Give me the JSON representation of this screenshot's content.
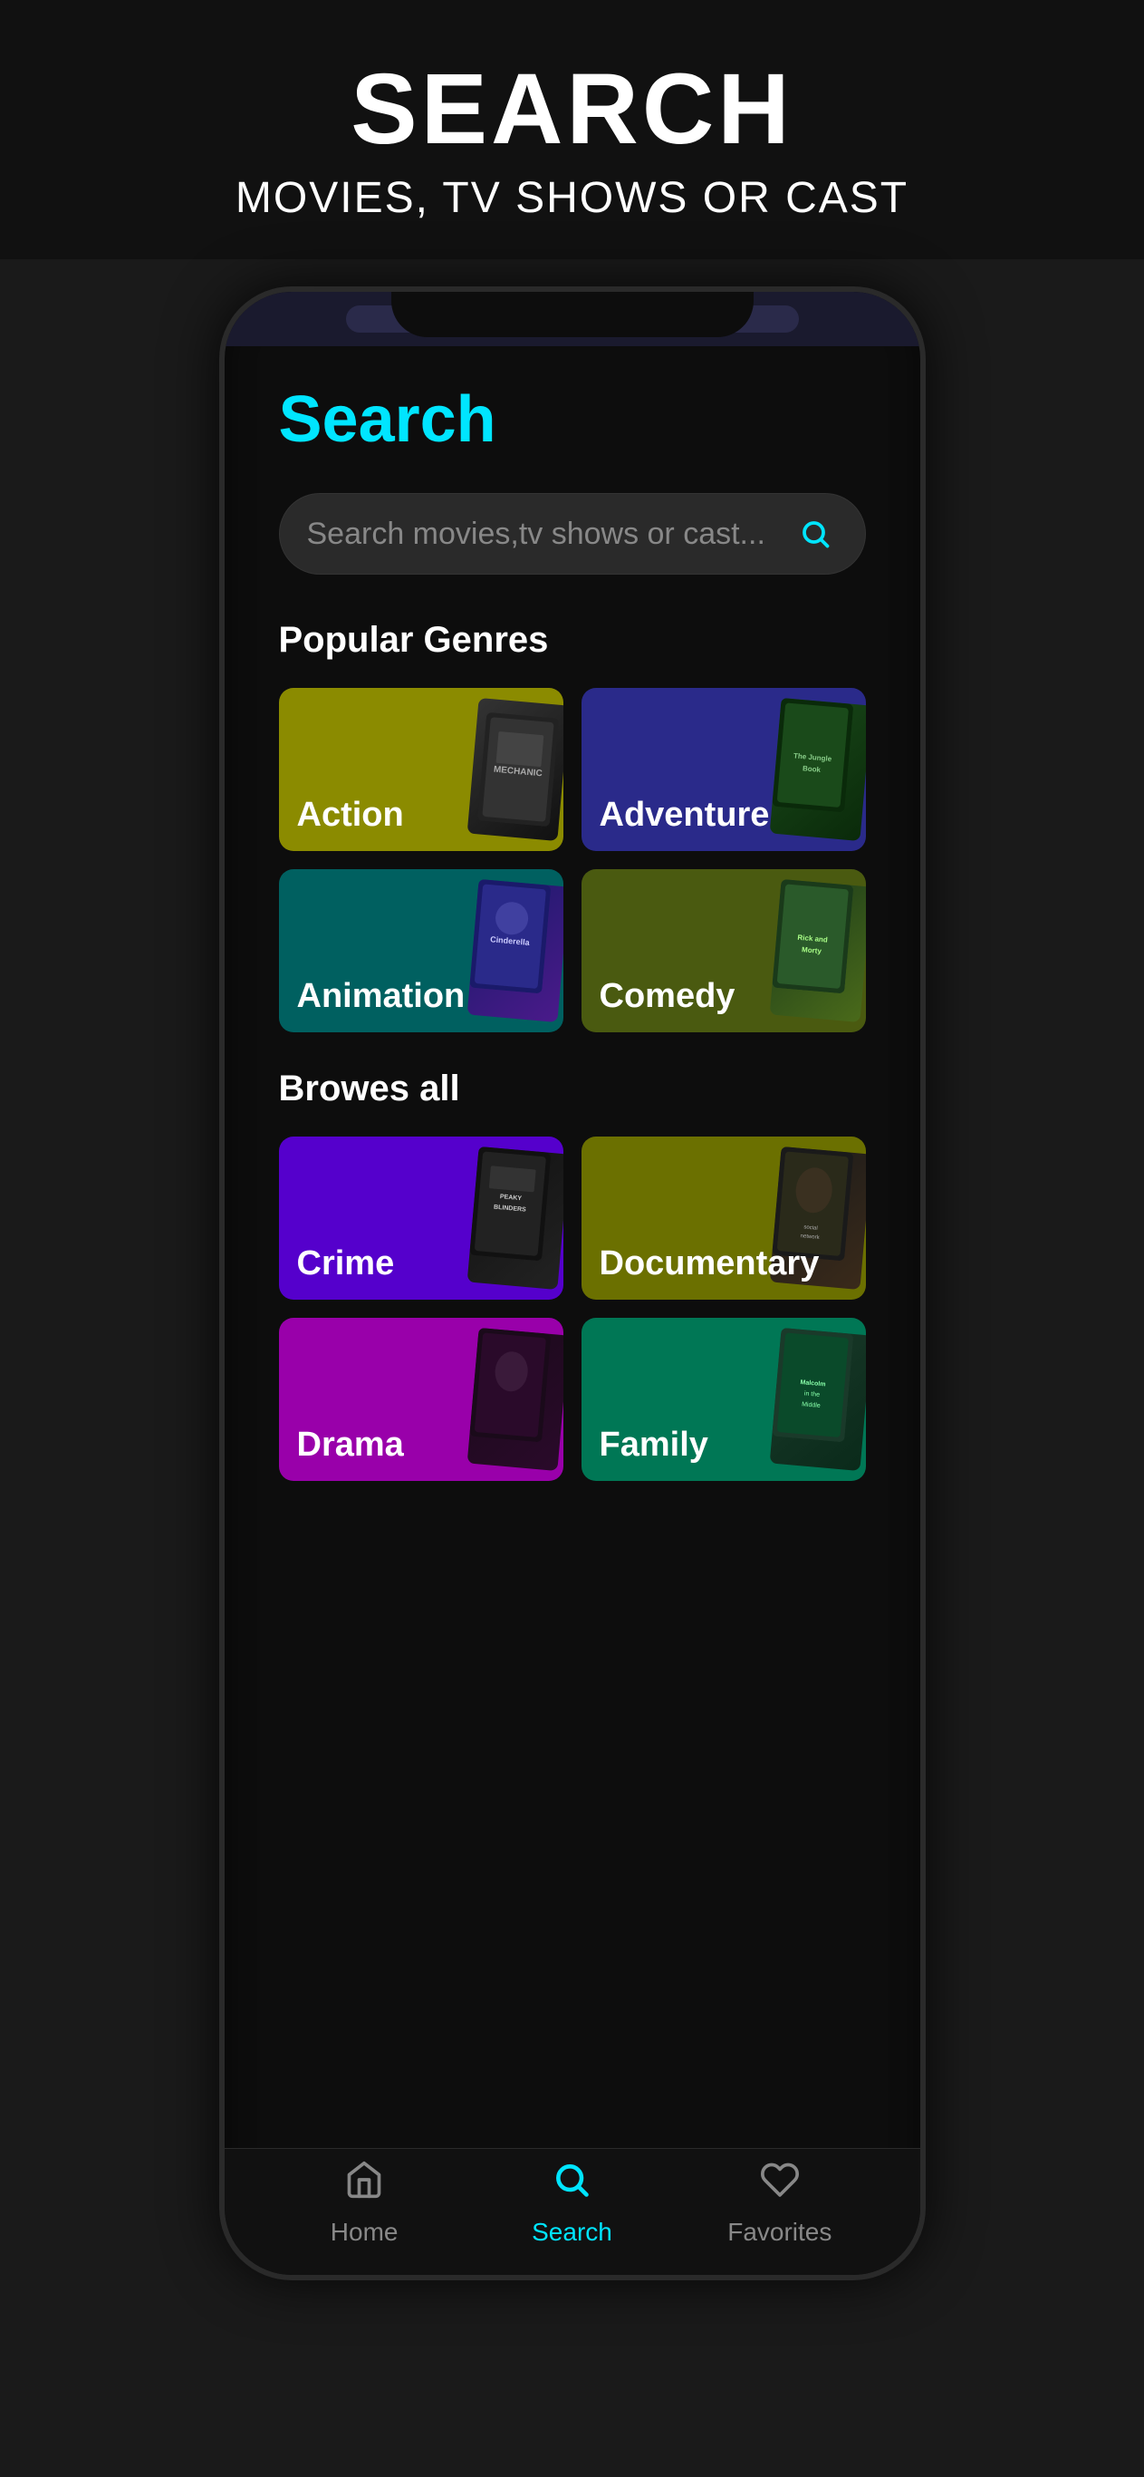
{
  "header": {
    "title": "SEARCH",
    "subtitle": "MOVIES, TV SHOWS OR CAST"
  },
  "search_page": {
    "title": "Search",
    "search_placeholder": "Search movies,tv shows or cast...",
    "popular_genres_label": "Popular Genres",
    "browses_all_label": "Browes all",
    "genres_popular": [
      {
        "id": "action",
        "label": "Action",
        "color": "action-card"
      },
      {
        "id": "adventure",
        "label": "Adventure",
        "color": "adventure-card"
      },
      {
        "id": "animation",
        "label": "Animation",
        "color": "animation-card"
      },
      {
        "id": "comedy",
        "label": "Comedy",
        "color": "comedy-card"
      }
    ],
    "genres_all": [
      {
        "id": "crime",
        "label": "Crime",
        "color": "crime-card"
      },
      {
        "id": "documentary",
        "label": "Documentary",
        "color": "documentary-card"
      },
      {
        "id": "drama",
        "label": "Drama",
        "color": "drama-card"
      },
      {
        "id": "family",
        "label": "Family",
        "color": "family-card"
      }
    ]
  },
  "bottom_nav": {
    "items": [
      {
        "id": "home",
        "label": "Home",
        "active": false
      },
      {
        "id": "search",
        "label": "Search",
        "active": true
      },
      {
        "id": "favorites",
        "label": "Favorites",
        "active": false
      }
    ]
  }
}
